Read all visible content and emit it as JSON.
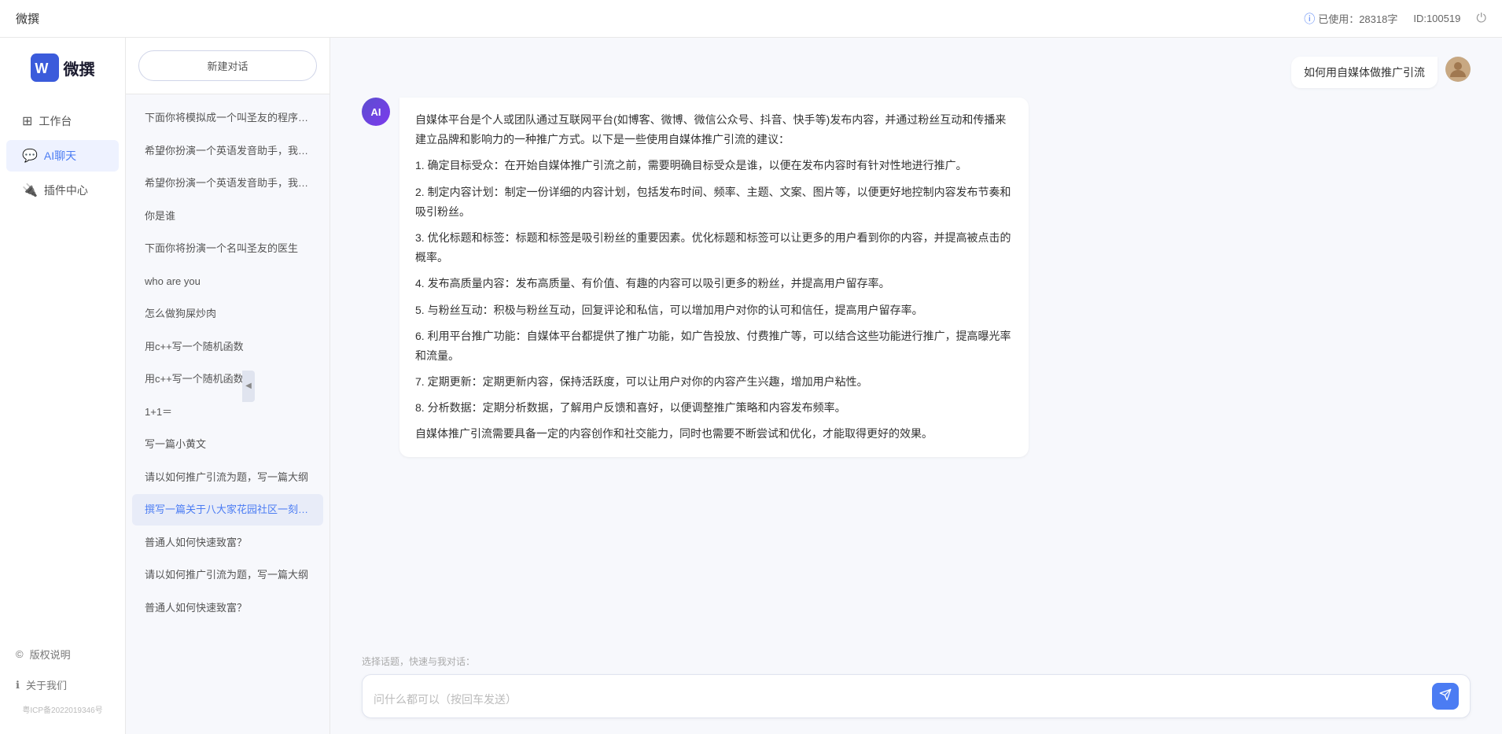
{
  "topbar": {
    "title": "微撰",
    "usage_label": "已使用：28318字",
    "id_label": "ID:100519",
    "info_icon": "ⓘ"
  },
  "logo": {
    "text": "微撰"
  },
  "nav": {
    "items": [
      {
        "id": "workbench",
        "label": "工作台",
        "icon": "⊞"
      },
      {
        "id": "ai-chat",
        "label": "AI聊天",
        "icon": "💬",
        "active": true
      },
      {
        "id": "plugin",
        "label": "插件中心",
        "icon": "🔌"
      }
    ]
  },
  "sidebar_bottom": {
    "items": [
      {
        "id": "copyright",
        "label": "版权说明",
        "icon": "©"
      },
      {
        "id": "about",
        "label": "关于我们",
        "icon": "ℹ"
      }
    ],
    "icp": "粤ICP备2022019346号"
  },
  "chat_history": {
    "new_btn": "新建对话",
    "items": [
      {
        "id": 1,
        "text": "下面你将模拟成一个叫圣友的程序员，我说...",
        "active": false
      },
      {
        "id": 2,
        "text": "希望你扮演一个英语发音助手，我提供给你...",
        "active": false
      },
      {
        "id": 3,
        "text": "希望你扮演一个英语发音助手，我提供给你...",
        "active": false
      },
      {
        "id": 4,
        "text": "你是谁",
        "active": false
      },
      {
        "id": 5,
        "text": "下面你将扮演一个名叫圣友的医生",
        "active": false
      },
      {
        "id": 6,
        "text": "who are you",
        "active": false
      },
      {
        "id": 7,
        "text": "怎么做狗屎炒肉",
        "active": false
      },
      {
        "id": 8,
        "text": "用c++写一个随机函数",
        "active": false
      },
      {
        "id": 9,
        "text": "用c++写一个随机函数",
        "active": false
      },
      {
        "id": 10,
        "text": "1+1＝",
        "active": false
      },
      {
        "id": 11,
        "text": "写一篇小黄文",
        "active": false
      },
      {
        "id": 12,
        "text": "请以如何推广引流为题，写一篇大纲",
        "active": false
      },
      {
        "id": 13,
        "text": "撰写一篇关于八大家花园社区一刻钟便民生...",
        "active": true
      },
      {
        "id": 14,
        "text": "普通人如何快速致富？",
        "active": false
      },
      {
        "id": 15,
        "text": "请以如何推广引流为题，写一篇大纲",
        "active": false
      },
      {
        "id": 16,
        "text": "普通人如何快速致富？",
        "active": false
      }
    ]
  },
  "chat": {
    "user_message": "如何用自媒体做推广引流",
    "ai_response": {
      "paragraphs": [
        "自媒体平台是个人或团队通过互联网平台(如博客、微博、微信公众号、抖音、快手等)发布内容，并通过粉丝互动和传播来建立品牌和影响力的一种推广方式。以下是一些使用自媒体推广引流的建议：",
        "1. 确定目标受众：在开始自媒体推广引流之前，需要明确目标受众是谁，以便在发布内容时有针对性地进行推广。",
        "2. 制定内容计划：制定一份详细的内容计划，包括发布时间、频率、主题、文案、图片等，以便更好地控制内容发布节奏和吸引粉丝。",
        "3. 优化标题和标签：标题和标签是吸引粉丝的重要因素。优化标题和标签可以让更多的用户看到你的内容，并提高被点击的概率。",
        "4. 发布高质量内容：发布高质量、有价值、有趣的内容可以吸引更多的粉丝，并提高用户留存率。",
        "5. 与粉丝互动：积极与粉丝互动，回复评论和私信，可以增加用户对你的认可和信任，提高用户留存率。",
        "6. 利用平台推广功能：自媒体平台都提供了推广功能，如广告投放、付费推广等，可以结合这些功能进行推广，提高曝光率和流量。",
        "7. 定期更新：定期更新内容，保持活跃度，可以让用户对你的内容产生兴趣，增加用户粘性。",
        "8. 分析数据：定期分析数据，了解用户反馈和喜好，以便调整推广策略和内容发布频率。",
        "自媒体推广引流需要具备一定的内容创作和社交能力，同时也需要不断尝试和优化，才能取得更好的效果。"
      ]
    }
  },
  "input": {
    "quick_topics": "选择话题，快速与我对话：",
    "placeholder": "问什么都可以（按回车发送）"
  },
  "colors": {
    "accent": "#4b7cf3",
    "ai_avatar_bg": "#5b4ecf"
  }
}
